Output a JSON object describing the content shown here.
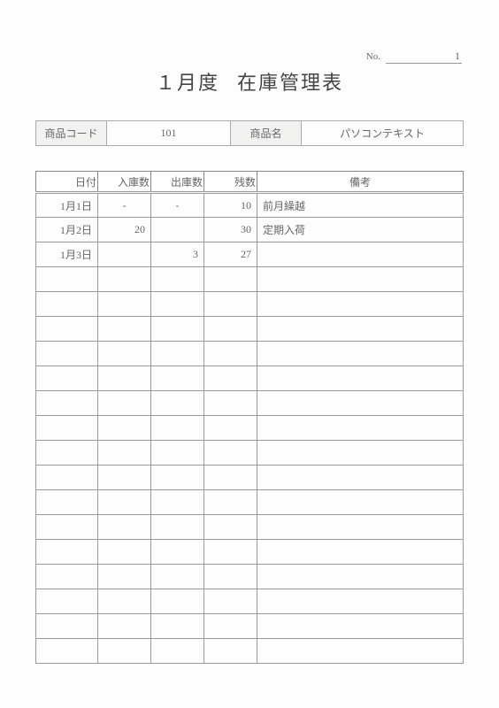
{
  "meta": {
    "no_label": "No.",
    "no_value": "1"
  },
  "title": {
    "month": "１月度",
    "heading": "在庫管理表"
  },
  "info": {
    "code_label": "商品コード",
    "code_value": "101",
    "name_label": "商品名",
    "name_value": "パソコンテキスト"
  },
  "columns": {
    "date": "日付",
    "in": "入庫数",
    "out": "出庫数",
    "remain": "残数",
    "note": "備考"
  },
  "rows": [
    {
      "date": "1月1日",
      "in": "-",
      "out": "-",
      "remain": "10",
      "note": "前月繰越",
      "center_in": true,
      "center_out": true
    },
    {
      "date": "1月2日",
      "in": "20",
      "out": "",
      "remain": "30",
      "note": "定期入荷"
    },
    {
      "date": "1月3日",
      "in": "",
      "out": "3",
      "remain": "27",
      "note": ""
    },
    {
      "date": "",
      "in": "",
      "out": "",
      "remain": "",
      "note": ""
    },
    {
      "date": "",
      "in": "",
      "out": "",
      "remain": "",
      "note": ""
    },
    {
      "date": "",
      "in": "",
      "out": "",
      "remain": "",
      "note": ""
    },
    {
      "date": "",
      "in": "",
      "out": "",
      "remain": "",
      "note": ""
    },
    {
      "date": "",
      "in": "",
      "out": "",
      "remain": "",
      "note": ""
    },
    {
      "date": "",
      "in": "",
      "out": "",
      "remain": "",
      "note": ""
    },
    {
      "date": "",
      "in": "",
      "out": "",
      "remain": "",
      "note": ""
    },
    {
      "date": "",
      "in": "",
      "out": "",
      "remain": "",
      "note": ""
    },
    {
      "date": "",
      "in": "",
      "out": "",
      "remain": "",
      "note": ""
    },
    {
      "date": "",
      "in": "",
      "out": "",
      "remain": "",
      "note": ""
    },
    {
      "date": "",
      "in": "",
      "out": "",
      "remain": "",
      "note": ""
    },
    {
      "date": "",
      "in": "",
      "out": "",
      "remain": "",
      "note": ""
    },
    {
      "date": "",
      "in": "",
      "out": "",
      "remain": "",
      "note": ""
    },
    {
      "date": "",
      "in": "",
      "out": "",
      "remain": "",
      "note": ""
    },
    {
      "date": "",
      "in": "",
      "out": "",
      "remain": "",
      "note": ""
    },
    {
      "date": "",
      "in": "",
      "out": "",
      "remain": "",
      "note": ""
    }
  ]
}
